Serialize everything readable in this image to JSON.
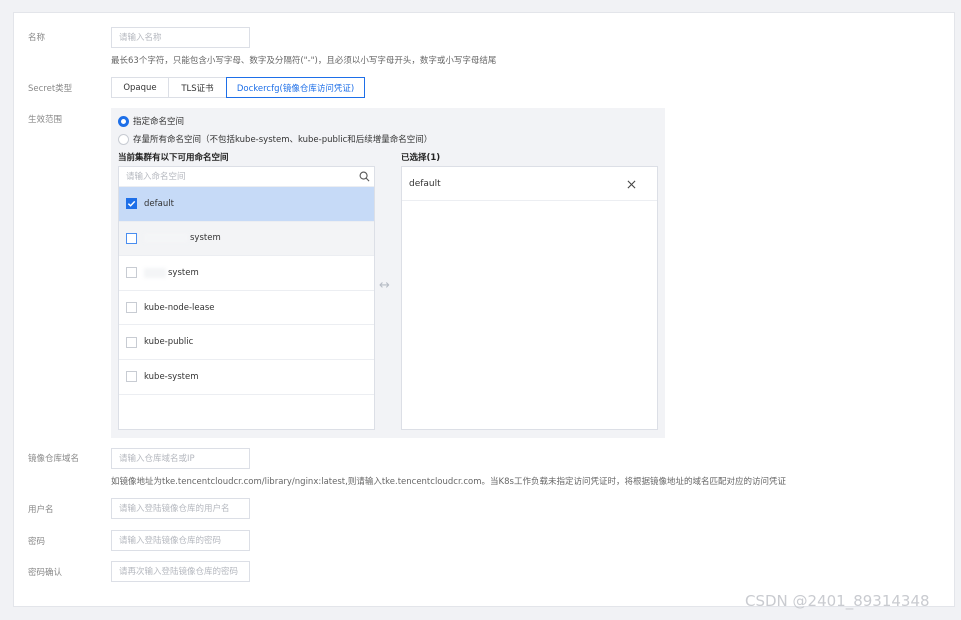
{
  "form": {
    "name": {
      "label": "名称",
      "placeholder": "请输入名称",
      "hint": "最长63个字符，只能包含小写字母、数字及分隔符(\"-\")，且必须以小写字母开头，数字或小写字母结尾"
    },
    "secret_type": {
      "label": "Secret类型",
      "tabs": [
        "Opaque",
        "TLS证书",
        "Dockercfg(镜像仓库访问凭证)"
      ],
      "active": "Dockercfg(镜像仓库访问凭证)"
    },
    "scope": {
      "label": "生效范围",
      "options": [
        "指定命名空间",
        "存量所有命名空间（不包括kube-system、kube-public和后续增量命名空间）"
      ],
      "selected": "指定命名空间",
      "available_title": "当前集群有以下可用命名空间",
      "search_placeholder": "请输入命名空间",
      "namespaces": [
        {
          "name": "default",
          "checked": true
        },
        {
          "name": "system",
          "checked": false,
          "redacted_prefix": true
        },
        {
          "name": "system",
          "checked": false,
          "redacted_prefix": true
        },
        {
          "name": "kube-node-lease",
          "checked": false
        },
        {
          "name": "kube-public",
          "checked": false
        },
        {
          "name": "kube-system",
          "checked": false
        }
      ],
      "transfer_icon": "↔",
      "selected_title": "已选择(1)",
      "selected_items": [
        "default"
      ]
    },
    "registry": {
      "label": "镜像仓库域名",
      "placeholder": "请输入仓库域名或IP",
      "hint": "如镜像地址为tke.tencentcloudcr.com/library/nginx:latest,则请输入tke.tencentcloudcr.com。当K8s工作负载未指定访问凭证时，将根据镜像地址的域名匹配对应的访问凭证"
    },
    "username": {
      "label": "用户名",
      "placeholder": "请输入登陆镜像仓库的用户名"
    },
    "password": {
      "label": "密码",
      "placeholder": "请输入登陆镜像仓库的密码"
    },
    "password_confirm": {
      "label": "密码确认",
      "placeholder": "请再次输入登陆镜像仓库的密码"
    }
  },
  "watermark": "CSDN @2401_89314348",
  "colors": {
    "accent": "#1e6fe8",
    "selected_row": "#c6daf7",
    "scope_bg": "#f2f3f6"
  }
}
